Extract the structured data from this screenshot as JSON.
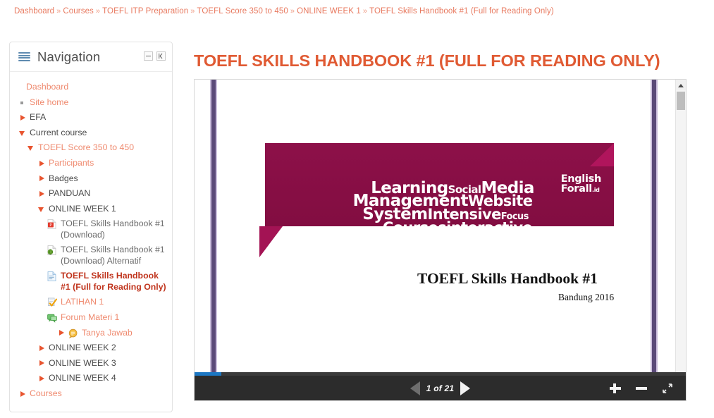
{
  "breadcrumb": {
    "separator": "»",
    "items": [
      "Dashboard",
      "Courses",
      "TOEFL ITP Preparation",
      "TOEFL Score 350 to 450",
      "ONLINE WEEK 1",
      "TOEFL Skills Handbook #1 (Full for Reading Only)"
    ]
  },
  "sidebar": {
    "title": "Navigation",
    "move_icon": "drag-handle-icon",
    "collapse_icon": "minus-icon",
    "dock_icon": "dock-left-icon",
    "items": [
      {
        "label": "Dashboard",
        "depth": 0,
        "marker": "none",
        "icon": "none",
        "style": "link"
      },
      {
        "label": "Site home",
        "depth": 1,
        "marker": "bullet",
        "icon": "none",
        "style": "link"
      },
      {
        "label": "EFA",
        "depth": 1,
        "marker": "right",
        "icon": "none",
        "style": "dark"
      },
      {
        "label": "Current course",
        "depth": 1,
        "marker": "down",
        "icon": "none",
        "style": "dark"
      },
      {
        "label": "TOEFL Score 350 to 450",
        "depth": 2,
        "marker": "down",
        "icon": "none",
        "style": "link"
      },
      {
        "label": "Participants",
        "depth": 3,
        "marker": "right",
        "icon": "none",
        "style": "link"
      },
      {
        "label": "Badges",
        "depth": 3,
        "marker": "right",
        "icon": "none",
        "style": "dark"
      },
      {
        "label": "PANDUAN",
        "depth": 3,
        "marker": "right",
        "icon": "none",
        "style": "dark"
      },
      {
        "label": "ONLINE WEEK 1",
        "depth": 3,
        "marker": "down",
        "icon": "none",
        "style": "dark"
      },
      {
        "label": "TOEFL Skills Handbook #1 (Download)",
        "depth": 4,
        "marker": "none",
        "icon": "pdf-file-icon",
        "style": "gray"
      },
      {
        "label": "TOEFL Skills Handbook #1 (Download) Alternatif",
        "depth": 4,
        "marker": "none",
        "icon": "url-link-icon",
        "style": "gray"
      },
      {
        "label": "TOEFL Skills Handbook #1 (Full for Reading Only)",
        "depth": 4,
        "marker": "none",
        "icon": "page-resource-icon",
        "style": "active"
      },
      {
        "label": "LATIHAN 1",
        "depth": 4,
        "marker": "none",
        "icon": "quiz-check-icon",
        "style": "link"
      },
      {
        "label": "Forum Materi 1",
        "depth": 4,
        "marker": "none",
        "icon": "forum-icon",
        "style": "link"
      },
      {
        "label": "Tanya Jawab",
        "depth": 5,
        "marker": "right",
        "icon": "discussion-icon",
        "style": "link"
      },
      {
        "label": "ONLINE WEEK 2",
        "depth": 3,
        "marker": "right",
        "icon": "none",
        "style": "dark"
      },
      {
        "label": "ONLINE WEEK 3",
        "depth": 3,
        "marker": "right",
        "icon": "none",
        "style": "dark"
      },
      {
        "label": "ONLINE WEEK 4",
        "depth": 3,
        "marker": "right",
        "icon": "none",
        "style": "dark"
      },
      {
        "label": "Courses",
        "depth": 1,
        "marker": "right",
        "icon": "none",
        "style": "link"
      }
    ]
  },
  "main": {
    "page_title": "TOEFL SKILLS HANDBOOK #1 (FULL FOR READING ONLY)",
    "title_color": "#e05a33"
  },
  "document": {
    "banner": {
      "background_color": "#8c0f47",
      "word_cloud": {
        "row1": [
          "Learning",
          "Social",
          "Media"
        ],
        "row2": [
          "Management",
          "Website"
        ],
        "row3": [
          "System",
          "Intensive",
          "Focus"
        ],
        "row4": [
          "Courses",
          "interactive"
        ]
      },
      "logo_line1": "English",
      "logo_line2": "Forall",
      "logo_suffix": ".id"
    },
    "title": "TOEFL Skills  Handbook #1",
    "subtitle": "Bandung 2016",
    "accent_line_color": "#5b4a79"
  },
  "viewer": {
    "page_label": "1 of 21",
    "current_page": 1,
    "total_pages": 21,
    "prev_icon": "previous-page-arrow-icon",
    "next_icon": "next-page-arrow-icon",
    "zoom_in_icon": "zoom-in-plus-icon",
    "zoom_out_icon": "zoom-out-minus-icon",
    "fullscreen_icon": "fullscreen-expand-icon",
    "progress_color": "#1c77c3",
    "toolbar_color": "#2c2c2c"
  }
}
